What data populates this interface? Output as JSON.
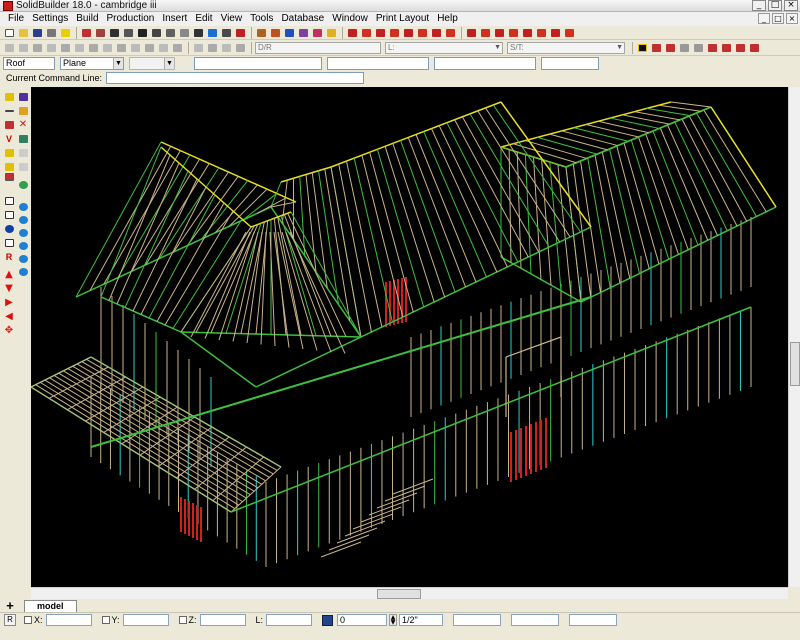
{
  "window": {
    "title": "SolidBuilder 18.0 - cambridge iii",
    "minimize": "_",
    "restore": "□",
    "close": "×"
  },
  "menu": [
    "File",
    "Settings",
    "Build",
    "Production",
    "Insert",
    "Edit",
    "View",
    "Tools",
    "Database",
    "Window",
    "Print Layout",
    "Help"
  ],
  "toolbar2": {
    "combo_dr": "D/R",
    "combo_l": "L:",
    "combo_st": "S/T:"
  },
  "properties": {
    "type_value": "Roof",
    "mode_value": "Plane",
    "third_value": ""
  },
  "command_line": {
    "label": "Current Command Line:",
    "value": ""
  },
  "tabs": {
    "add_label": "+",
    "active": "model"
  },
  "status": {
    "r_button": "R",
    "x_label": "X:",
    "y_label": "Y:",
    "z_label": "Z:",
    "l_label": "L:",
    "angle_value": "0",
    "fraction_value": "1/2\""
  },
  "colors": {
    "canvas_bg": "#000000",
    "framing_tan": "#c8b48a",
    "framing_green": "#3fbf3f",
    "framing_yellow": "#e8e020",
    "framing_cyan": "#2fd0d0",
    "framing_red": "#d02020"
  }
}
